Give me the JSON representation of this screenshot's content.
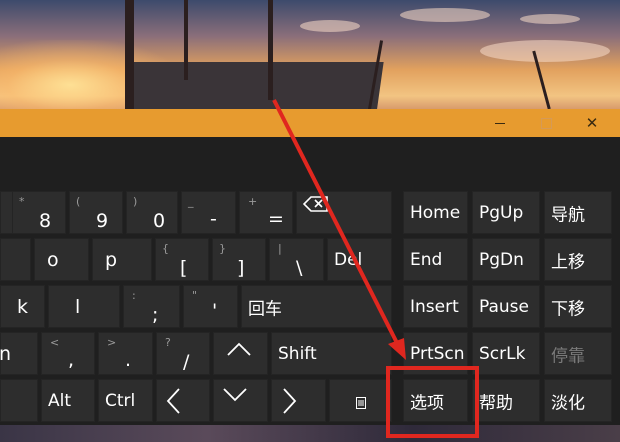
{
  "window": {
    "controls": {
      "minimize": "—",
      "maximize": "□",
      "close": "✕"
    }
  },
  "keys": {
    "star": {
      "sub": "*",
      "main": "8"
    },
    "paren_open": {
      "sub": "(",
      "main": "9"
    },
    "paren_close": {
      "sub": ")",
      "main": "0"
    },
    "underscore": {
      "sub": "_",
      "main": "-"
    },
    "plus": {
      "sub": "+",
      "main": "="
    },
    "o": {
      "main": "o"
    },
    "p": {
      "main": "p"
    },
    "brace_open": {
      "sub": "{",
      "main": "["
    },
    "brace_close": {
      "sub": "}",
      "main": "]"
    },
    "pipe": {
      "sub": "|",
      "main": "\\"
    },
    "del": {
      "main": "Del"
    },
    "k": {
      "main": "k"
    },
    "l": {
      "main": "l"
    },
    "colon": {
      "sub": ":",
      "main": ";"
    },
    "quote": {
      "sub": "\"",
      "main": "'"
    },
    "enter": {
      "main": "回车"
    },
    "n": {
      "main": "n"
    },
    "lt": {
      "sub": "<",
      "main": ","
    },
    "gt": {
      "sub": ">",
      "main": "."
    },
    "question": {
      "sub": "?",
      "main": "/"
    },
    "up": {
      "main": "^"
    },
    "shift": {
      "main": "Shift"
    },
    "alt": {
      "main": "Alt"
    },
    "ctrl": {
      "main": "Ctrl"
    },
    "left": {
      "main": "<"
    },
    "down": {
      "main": "v"
    },
    "right": {
      "main": ">"
    },
    "menu": {
      "main": "▤"
    },
    "home": "Home",
    "pgup": "PgUp",
    "nav": "导航",
    "end": "End",
    "pgdn": "PgDn",
    "moveup": "上移",
    "insert": "Insert",
    "pause": "Pause",
    "movedown": "下移",
    "prtscn": "PrtScn",
    "scrlk": "ScrLk",
    "dock": "停靠",
    "options": "选项",
    "help": "帮助",
    "fade": "淡化"
  },
  "icons": {
    "backspace": "backspace-icon",
    "menu": "context-menu-icon"
  },
  "colors": {
    "titlebar": "#e79b2f",
    "key_bg": "#2d2d2d",
    "panel_bg": "#1f1f1f",
    "annotation": "#e0271f"
  }
}
